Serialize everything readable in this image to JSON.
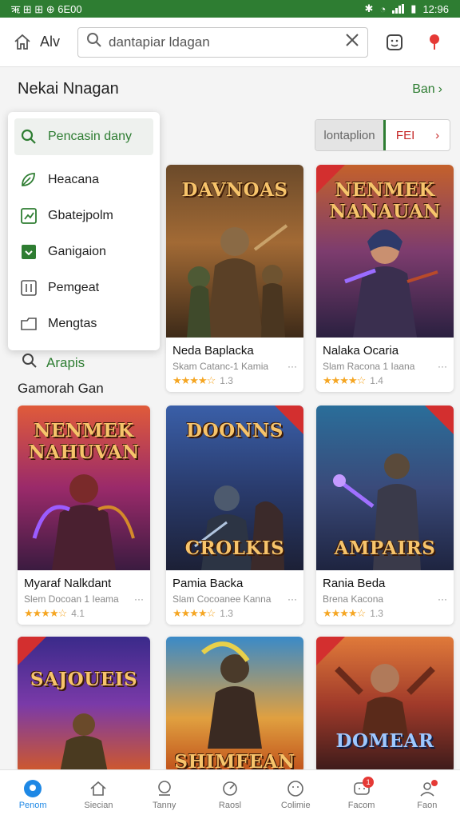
{
  "status": {
    "left_text": "ऋ ⊞ ⊞ ⊕ 6E00",
    "time": "12:96"
  },
  "topbar": {
    "app_label": "Alv",
    "search_value": "dantapiar ldagan",
    "search_placeholder": "dantapiar ldagan"
  },
  "section": {
    "title": "Nekai Nnagan",
    "see_all": "Ban"
  },
  "menu": {
    "items": [
      {
        "label": "Pencasin dany",
        "icon": "search-icon"
      },
      {
        "label": "Heacana",
        "icon": "leaf-icon"
      },
      {
        "label": "Gbatejpolm",
        "icon": "chart-icon"
      },
      {
        "label": "Ganigaion",
        "icon": "inbox-icon"
      },
      {
        "label": "Pemgeat",
        "icon": "sliders-icon"
      },
      {
        "label": "Mengtas",
        "icon": "folder-icon"
      }
    ]
  },
  "filter": {
    "left": "lontaplion",
    "right": "FEI"
  },
  "link_row": {
    "label": "Arapis"
  },
  "subhead": "Gamorah Gan",
  "cards": [
    {
      "cover_title": "DAVNOAS",
      "name": "Neda Baplacka",
      "sub": "Skam Catanc-1 Kamia",
      "rating": "1.3"
    },
    {
      "cover_title": "NENMEK NANAUAN",
      "name": "Nalaka Ocaria",
      "sub": "Slam Racona 1 Iaana",
      "rating": "1.4"
    },
    {
      "cover_title": "NENMEK NAHUVAN",
      "name": "Myaraf Nalkdant",
      "sub": "Slem Docoan 1 Ieama",
      "rating": "4.1"
    },
    {
      "cover_title": "DOONNS",
      "cover_title2": "CROLKIS",
      "name": "Pamia Backa",
      "sub": "Slam Cocoanee Kanna",
      "rating": "1.3"
    },
    {
      "cover_title": "AMPAIRS",
      "name": "Rania Beda",
      "sub": "Brena Kacona",
      "rating": "1.3"
    },
    {
      "cover_title": "SAJOUEIS",
      "name": "",
      "sub": "",
      "rating": ""
    },
    {
      "cover_title": "SHIMFEAN",
      "name": "",
      "sub": "",
      "rating": ""
    },
    {
      "cover_title": "DOMEAR",
      "name": "",
      "sub": "",
      "rating": ""
    }
  ],
  "bottom_tabs": [
    {
      "label": "Penom",
      "active": true
    },
    {
      "label": "Siecian",
      "active": false
    },
    {
      "label": "Tanny",
      "active": false
    },
    {
      "label": "Raosl",
      "active": false
    },
    {
      "label": "Colimie",
      "active": false
    },
    {
      "label": "Facom",
      "active": false,
      "badge": "1"
    },
    {
      "label": "Faon",
      "active": false
    }
  ],
  "colors": {
    "accent": "#2e7d32",
    "active_tab": "#1e88e5",
    "star": "#f5a623"
  }
}
